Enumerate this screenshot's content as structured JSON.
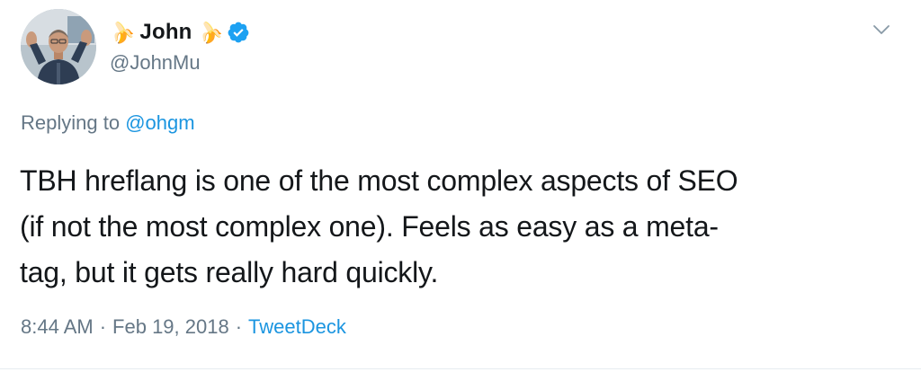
{
  "author": {
    "display_name": "John",
    "name_emoji_left": "🍌",
    "name_emoji_right": "🍌",
    "handle": "@JohnMu",
    "verified": true,
    "avatar_icon": "user-avatar-photo"
  },
  "reply": {
    "prefix": "Replying to",
    "mention": "@ohgm"
  },
  "tweet": {
    "lines": [
      "TBH hreflang is one of the most complex aspects of SEO",
      "(if not the most complex one). Feels as easy as a meta-",
      "tag, but it gets really hard quickly."
    ]
  },
  "meta": {
    "time": "8:44 AM",
    "separator": "·",
    "date": "Feb 19, 2018",
    "source": "TweetDeck"
  },
  "colors": {
    "text": "#14171a",
    "secondary": "#657786",
    "link": "#1b95e0",
    "verified": "#1da1f2",
    "divider": "#e6ecf0"
  },
  "icons": {
    "menu_caret": "chevron-down-icon",
    "verified": "verified-badge-icon"
  }
}
